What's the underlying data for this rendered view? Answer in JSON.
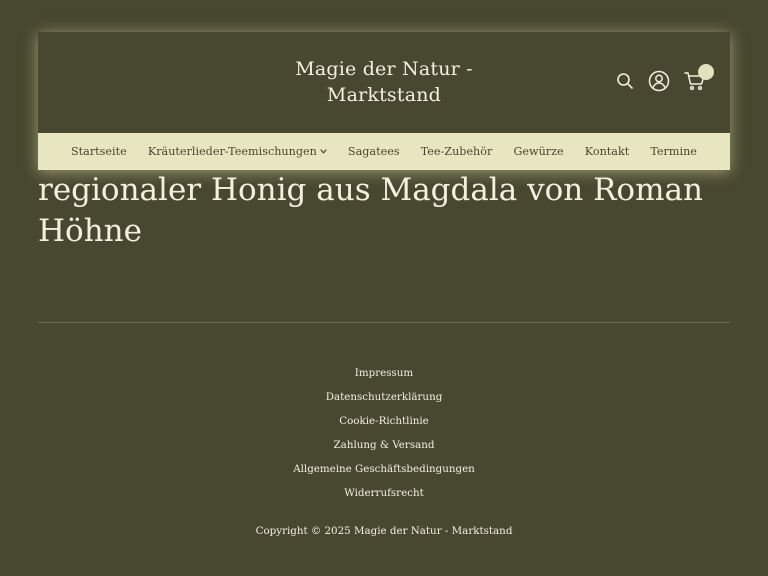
{
  "colors": {
    "background": "#484831",
    "nav_background": "#e8e6c0",
    "text_light": "#f3f1dd",
    "text_dark": "#484831",
    "header_glow": "#e6e2aa"
  },
  "header": {
    "title_line1": "Magie der Natur -",
    "title_line2": "Marktstand",
    "icons": {
      "search": "search-icon",
      "account": "user-circle-icon",
      "cart": "shopping-cart-icon"
    }
  },
  "nav": {
    "items": [
      {
        "label": "Startseite"
      },
      {
        "label": "Kräuterlieder-Teemischungen",
        "has_dropdown": true
      },
      {
        "label": "Sagatees"
      },
      {
        "label": "Tee-Zubehör"
      },
      {
        "label": "Gewürze"
      },
      {
        "label": "Kontakt"
      },
      {
        "label": "Termine"
      }
    ]
  },
  "main": {
    "heading": "regionaler Honig aus Magdala von Roman Höhne"
  },
  "footer": {
    "links": [
      {
        "label": "Impressum"
      },
      {
        "label": "Datenschutzerklärung"
      },
      {
        "label": "Cookie-Richtlinie"
      },
      {
        "label": "Zahlung & Versand"
      },
      {
        "label": "Allgemeine Geschäftsbedingungen"
      },
      {
        "label": "Widerrufsrecht"
      }
    ],
    "copyright": "Copyright © 2025 Magie der Natur - Marktstand"
  }
}
